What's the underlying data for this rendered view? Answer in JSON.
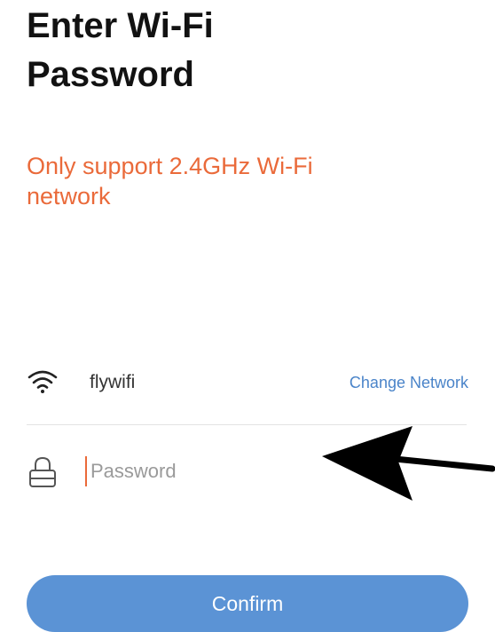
{
  "header": {
    "title_line1": "Enter Wi-Fi",
    "title_line2": "Password"
  },
  "notice": {
    "text_line1": "Only support 2.4GHz Wi-Fi",
    "text_line2": "network",
    "color": "#ea6a3a"
  },
  "network": {
    "icon": "wifi-icon",
    "ssid": "flywifi",
    "change_label": "Change Network",
    "link_color": "#4a84c9"
  },
  "password": {
    "icon": "lock-icon",
    "value": "",
    "placeholder": "Password"
  },
  "annotation": {
    "icon": "arrow-left-icon"
  },
  "confirm": {
    "label": "Confirm",
    "color": "#5b93d5"
  }
}
